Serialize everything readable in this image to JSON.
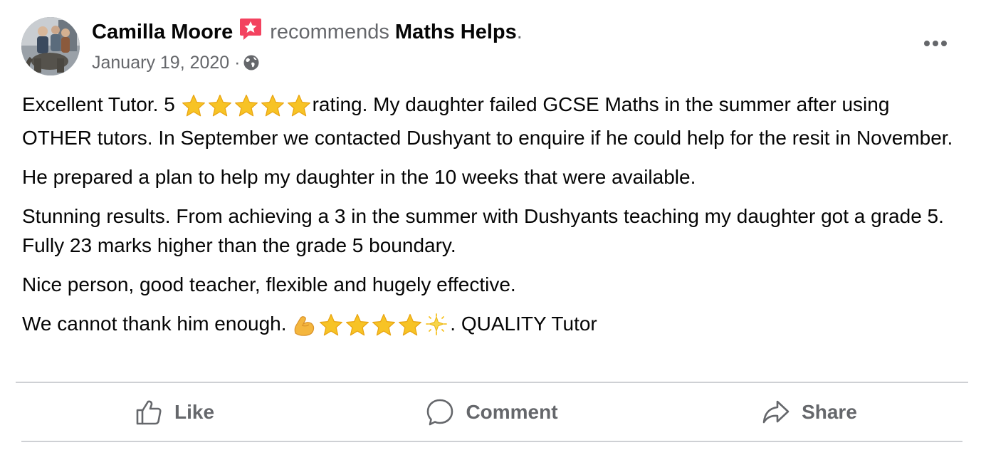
{
  "post": {
    "author": "Camilla Moore",
    "verb": "recommends",
    "page": "Maths Helps",
    "page_suffix": ".",
    "date": "January 19, 2020",
    "meta_separator": "·",
    "audience_icon": "globe-icon",
    "paragraphs": {
      "p1_a": "Excellent Tutor. 5 ",
      "p1_b": "rating. My daughter failed GCSE Maths in the summer after using OTHER tutors. In September we contacted Dushyant to enquire if he could help for the resit in November.",
      "p2": "He prepared a plan to help my daughter in the 10 weeks that were available.",
      "p3": "Stunning results. From achieving a 3 in the summer with Dushyants teaching my daughter got a grade 5. Fully 23 marks higher than the grade 5 boundary.",
      "p4": "Nice person, good teacher, flexible and hugely effective.",
      "p5_a": "We cannot thank him enough. ",
      "p5_b": ". QUALITY Tutor"
    },
    "emojis": {
      "rating_stars": [
        "star",
        "star",
        "star",
        "star",
        "star"
      ],
      "closing": [
        "flexed-biceps",
        "star",
        "star",
        "star",
        "star",
        "glowing-star"
      ]
    }
  },
  "actions": {
    "like": "Like",
    "comment": "Comment",
    "share": "Share"
  },
  "colors": {
    "text_primary": "#050505",
    "text_secondary": "#65676b",
    "divider": "#ced0d4",
    "recommend_badge": "#f3425f",
    "star": "#f7c325"
  }
}
